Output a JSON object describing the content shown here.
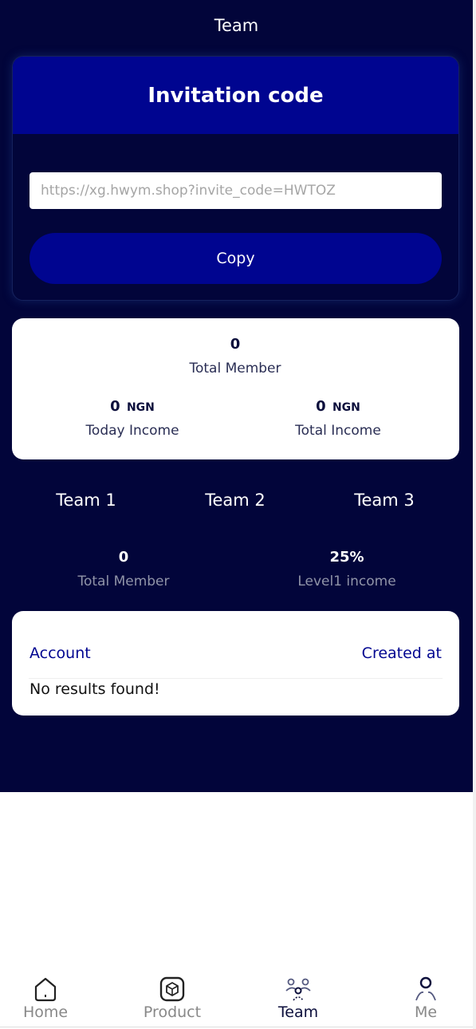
{
  "header": {
    "title": "Team"
  },
  "invite": {
    "title": "Invitation code",
    "link_placeholder": "https://xg.hwym.shop?invite_code=HWTOZ",
    "copy_label": "Copy"
  },
  "stats": {
    "total_member_value": "0",
    "total_member_label": "Total Member",
    "today_income_value": "0",
    "today_income_unit": "NGN",
    "today_income_label": "Today Income",
    "total_income_value": "0",
    "total_income_unit": "NGN",
    "total_income_label": "Total Income"
  },
  "teams": {
    "tabs": [
      {
        "label": "Team 1"
      },
      {
        "label": "Team 2"
      },
      {
        "label": "Team 3"
      }
    ],
    "total_member_value": "0",
    "total_member_label": "Total Member",
    "income_rate_value": "25%",
    "income_rate_label": "Level1 income"
  },
  "members_table": {
    "columns": [
      "Account",
      "Created at"
    ],
    "empty_message": "No results found!"
  },
  "tabbar": {
    "items": [
      {
        "label": "Home",
        "icon": "home-icon",
        "active": false
      },
      {
        "label": "Product",
        "icon": "product-box-icon",
        "active": false
      },
      {
        "label": "Team",
        "icon": "team-icon",
        "active": true
      },
      {
        "label": "Me",
        "icon": "user-icon",
        "active": false
      }
    ]
  },
  "colors": {
    "background_dark": "#02053a",
    "accent_blue": "#000590",
    "card_white": "#ffffff",
    "muted_text": "#9094a8"
  }
}
